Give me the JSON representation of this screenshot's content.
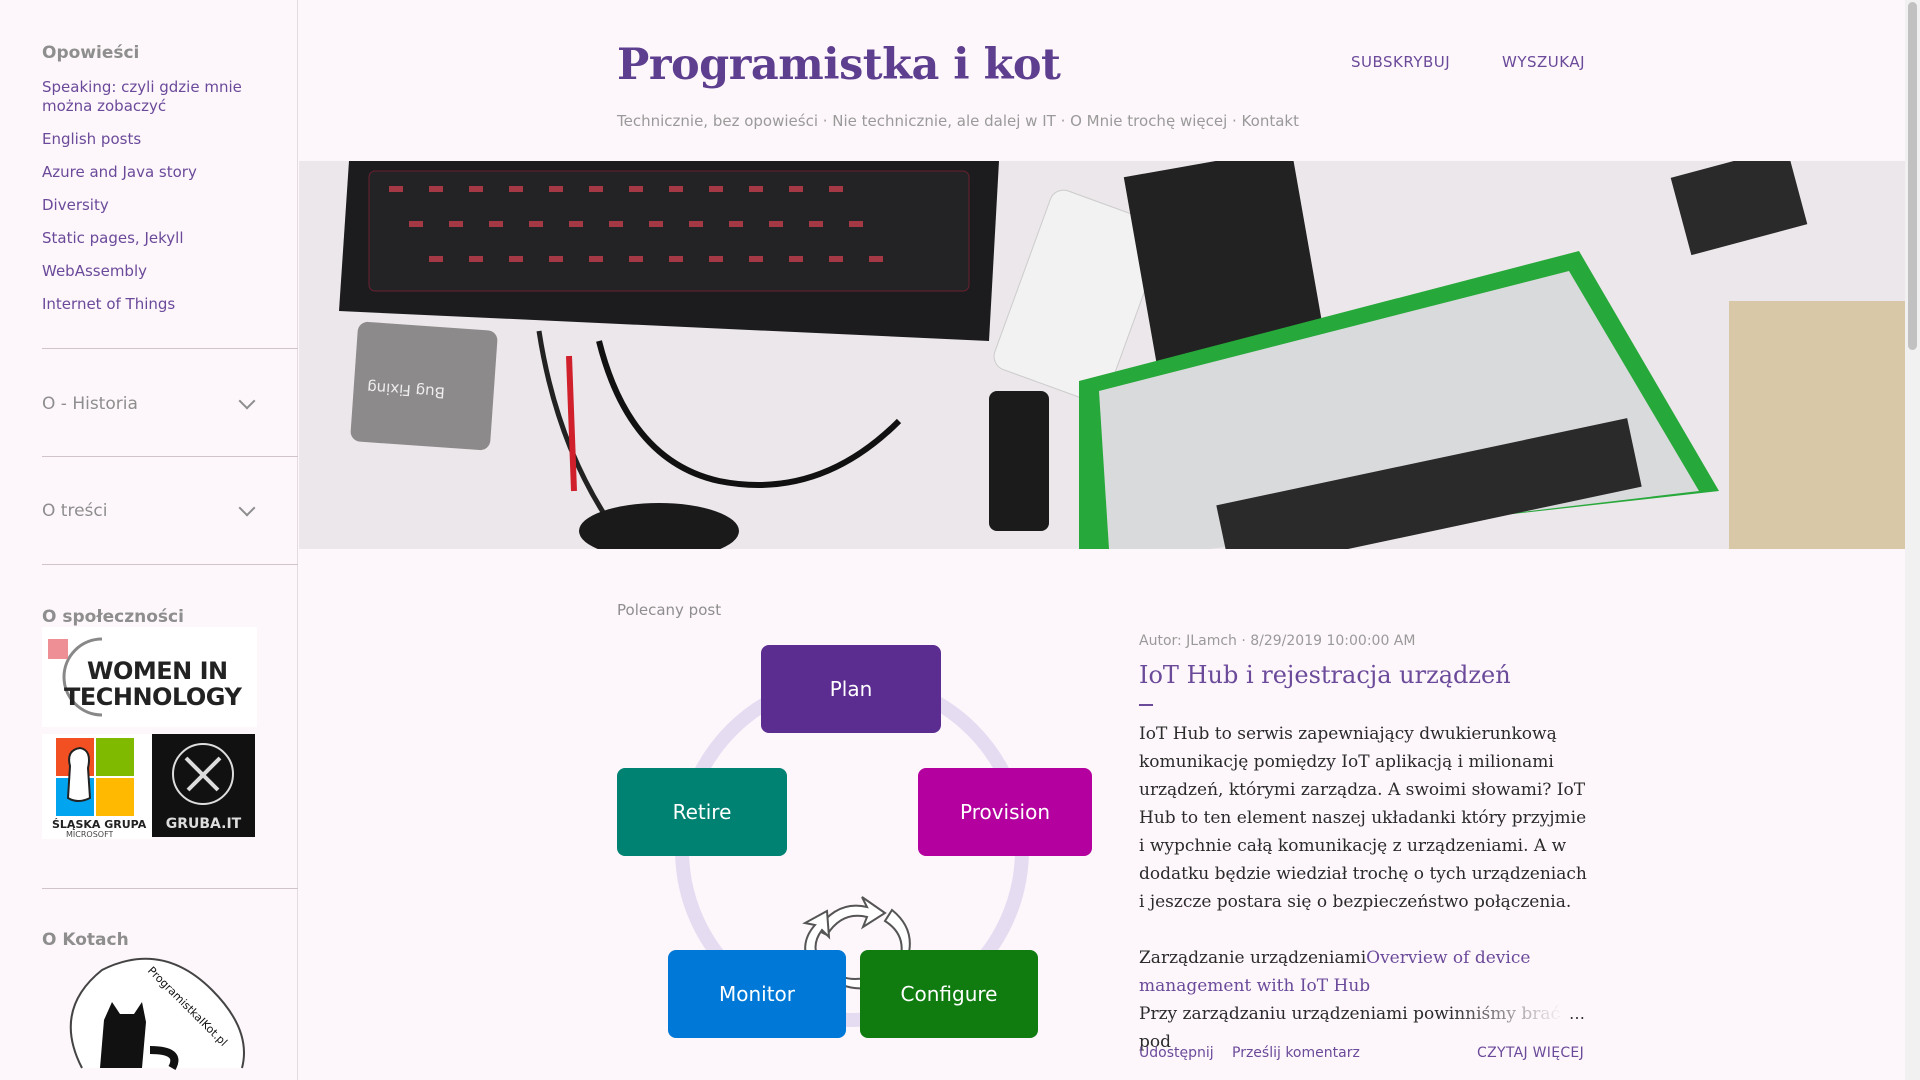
{
  "sidebar": {
    "stories_heading": "Opowieści",
    "links": [
      "Speaking: czyli gdzie mnie można zobaczyć",
      "English posts",
      "Azure and Java story",
      "Diversity",
      "Static pages, Jekyll",
      "WebAssembly",
      "Internet of Things"
    ],
    "history_heading": "O - Historia",
    "content_heading": "O treści",
    "community_heading": "O społeczności",
    "community_logos": {
      "women_in_tech_line1": "WOMEN IN",
      "women_in_tech_line2": "TECHNOLOGY",
      "slaska_line1": "ŚLĄSKA GRUPA",
      "slaska_line2": "MICROSOFT",
      "gruba": "GRUBA.IT"
    },
    "cats_heading": "O Kotach",
    "cats_badge_text": "ProgramistkaIKot.pl"
  },
  "header": {
    "title": "Programistka i kot",
    "nav_subscribe": "SUBSKRYBUJ",
    "nav_search": "WYSZUKAJ",
    "description": "Technicznie, bez opowieści · Nie technicznie, ale dalej w IT · O Mnie trochę więcej · Kontakt"
  },
  "hero": {
    "mousepad_text": "Bug Fixing"
  },
  "featured": {
    "label": "Polecany post",
    "diagram": {
      "plan": "Plan",
      "provision": "Provision",
      "retire": "Retire",
      "monitor": "Monitor",
      "configure": "Configure"
    },
    "meta": "Autor: JLamch · 8/29/2019 10:00:00 AM",
    "title": "IoT Hub i rejestracja urządzeń",
    "body_p1": "IoT Hub to serwis zapewniający dwukierunkową komunikację pomiędzy IoT aplikacją i milionami urządzeń, którymi zarządza. A swoimi słowami? IoT Hub to ten element naszej układanki który przyjmie i wypchnie całą komunikację z urządzeniami. A w dodatku będzie wiedział trochę o tych urządzeniach i jeszcze postara się o bezpieczeństwo połączenia.",
    "body_p2_text": "Zarządzanie urządzeniami",
    "body_p2_link": "Overview of device management with IoT Hub",
    "body_p3": "Przy zarządzaniu urządzeniami powinniśmy brać pod",
    "ellipsis": "…",
    "share": "Udostępnij",
    "comment": "Prześlij komentarz",
    "read_more": "CZYTAJ WIĘCEJ"
  },
  "colors": {
    "accent": "#6b4a9a",
    "title": "#5e3f8f",
    "background": "#fdf7fb",
    "plan": "#5c2d91",
    "provision": "#b4009e",
    "retire": "#008272",
    "monitor": "#0078d7",
    "configure": "#107c10"
  }
}
